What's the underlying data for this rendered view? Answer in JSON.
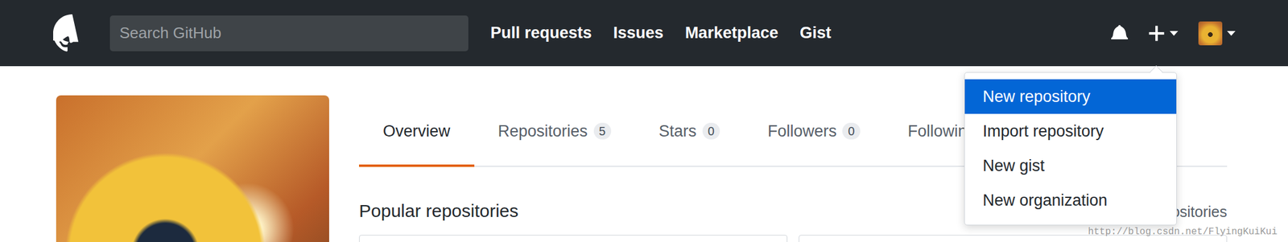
{
  "header": {
    "search_placeholder": "Search GitHub",
    "nav": [
      "Pull requests",
      "Issues",
      "Marketplace",
      "Gist"
    ]
  },
  "profile_tabs": [
    {
      "label": "Overview",
      "selected": true
    },
    {
      "label": "Repositories",
      "count": "5",
      "selected": false
    },
    {
      "label": "Stars",
      "count": "0",
      "selected": false
    },
    {
      "label": "Followers",
      "count": "0",
      "selected": false
    },
    {
      "label": "Following",
      "selected": false
    }
  ],
  "create_menu": {
    "open": true,
    "items": [
      {
        "label": "New repository",
        "selected": true
      },
      {
        "label": "Import repository",
        "selected": false
      },
      {
        "label": "New gist",
        "selected": false
      },
      {
        "label": "New organization",
        "selected": false
      }
    ]
  },
  "section": {
    "title": "Popular repositories",
    "link": "Customize your pinned repositories"
  },
  "watermark": "http://blog.csdn.net/FlyingKuiKui"
}
